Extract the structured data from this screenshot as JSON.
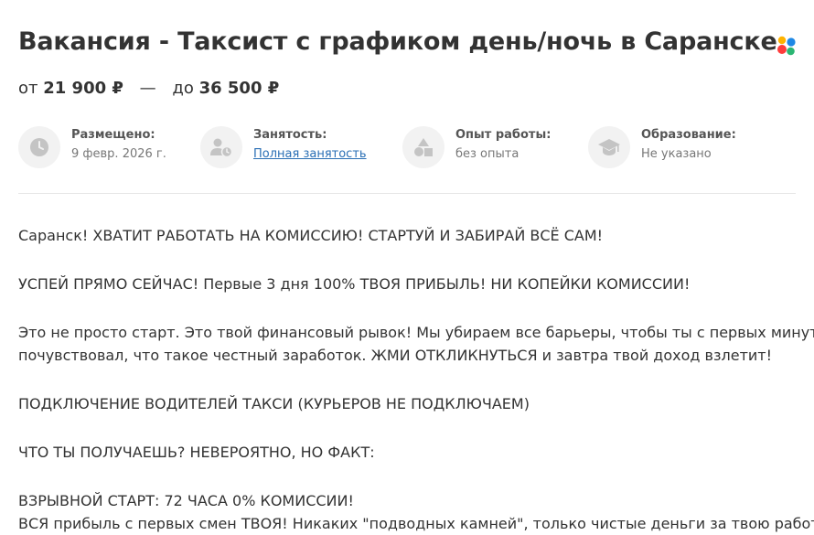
{
  "vacancy": {
    "title": "Вакансия - Таксист с графиком день/ночь в Саранске",
    "salary": {
      "from_prefix": "от",
      "from_amount": "21 900 ₽",
      "separator": "—",
      "to_prefix": "до",
      "to_amount": "36 500 ₽"
    }
  },
  "logo": {
    "icon": "colored-dots-logo",
    "colors": [
      "#ff3b3b",
      "#2bb673",
      "#1e88e5",
      "#ffb300"
    ]
  },
  "meta": [
    {
      "icon": "clock-icon",
      "label": "Размещено:",
      "value": "9 февр. 2026 г.",
      "link": false
    },
    {
      "icon": "user-clock-icon",
      "label": "Занятость:",
      "value": "Полная занятость",
      "link": true
    },
    {
      "icon": "shapes-icon",
      "label": "Опыт работы:",
      "value": "без опыта",
      "link": false
    },
    {
      "icon": "graduation-cap-icon",
      "label": "Образование:",
      "value": "Не указано",
      "link": false
    }
  ],
  "description": [
    "Саранск! ХВАТИТ РАБОТАТЬ НА КОМИССИЮ! СТАРТУЙ И ЗАБИРАЙ ВСЁ САМ!",
    "УСПЕЙ ПРЯМО СЕЙЧАС! Первые 3 дня 100% ТВОЯ ПРИБЫЛЬ! НИ КОПЕЙКИ КОМИССИИ!",
    "Это не просто старт. Это твой финансовый рывок! Мы убираем все барьеры, чтобы ты с первых минут",
    "почувствовал, что такое честный заработок. ЖМИ ОТКЛИКНУТЬСЯ и завтра твой доход взлетит!",
    "ПОДКЛЮЧЕНИЕ ВОДИТЕЛЕЙ ТАКСИ (КУРЬЕРОВ НЕ ПОДКЛЮЧАЕМ)",
    "ЧТО ТЫ ПОЛУЧАЕШЬ? НЕВЕРОЯТНО, НО ФАКТ:",
    "ВЗРЫВНОЙ СТАРТ: 72 ЧАСА 0% КОМИССИИ!",
    "ВСЯ прибыль с первых смен ТВОЯ! Никаких \"подводных камней\", только чистые деньги за твою работу."
  ],
  "colors": {
    "text": "#333333",
    "muted": "#777777",
    "link": "#2a6fb5",
    "icon_bg": "#f2f2f2",
    "icon": "#c4c4c4"
  }
}
